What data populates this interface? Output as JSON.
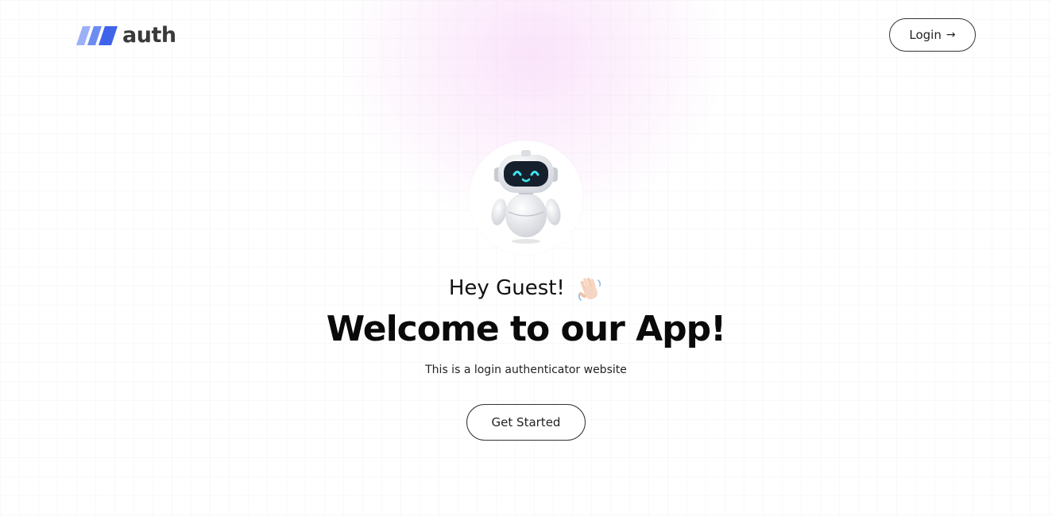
{
  "brand": {
    "name": "auth",
    "accent_color": "#5b7cf0"
  },
  "header": {
    "login_label": "Login",
    "login_icon": "arrow-right-icon"
  },
  "hero": {
    "avatar_icon": "robot-icon",
    "greeting": "Hey Guest!",
    "greeting_icon": "waving-hand-icon",
    "title": "Welcome to our App!",
    "subtitle": "This is a login authenticator website",
    "cta_label": "Get Started"
  }
}
